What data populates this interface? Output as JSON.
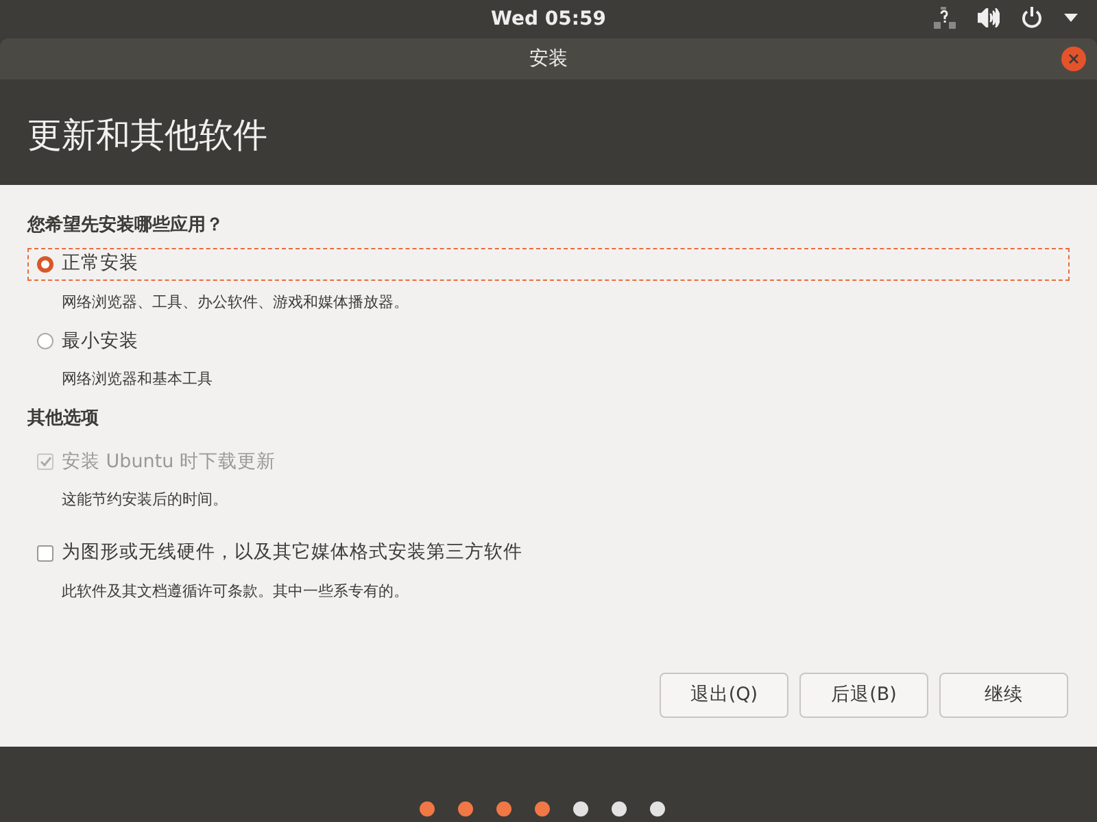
{
  "top_bar": {
    "clock": "Wed 05:59"
  },
  "window": {
    "title": "安装"
  },
  "page_title": "更新和其他软件",
  "question": "您希望先安装哪些应用？",
  "install_options": [
    {
      "label": "正常安装",
      "description": "网络浏览器、工具、办公软件、游戏和媒体播放器。",
      "selected": true
    },
    {
      "label": "最小安装",
      "description": "网络浏览器和基本工具",
      "selected": false
    }
  ],
  "other_heading": "其他选项",
  "other_options": [
    {
      "label": "安装 Ubuntu 时下载更新",
      "description": "这能节约安装后的时间。",
      "checked": true,
      "disabled": true
    },
    {
      "label": "为图形或无线硬件，以及其它媒体格式安装第三方软件",
      "description": "此软件及其文档遵循许可条款。其中一些系专有的。",
      "checked": false,
      "disabled": false
    }
  ],
  "buttons": [
    {
      "label": "退出(Q)"
    },
    {
      "label": "后退(B)"
    },
    {
      "label": "继续"
    }
  ],
  "progress_steps": [
    {
      "done": true
    },
    {
      "done": true
    },
    {
      "done": true
    },
    {
      "done": true
    },
    {
      "done": false
    },
    {
      "done": false
    },
    {
      "done": false
    }
  ]
}
